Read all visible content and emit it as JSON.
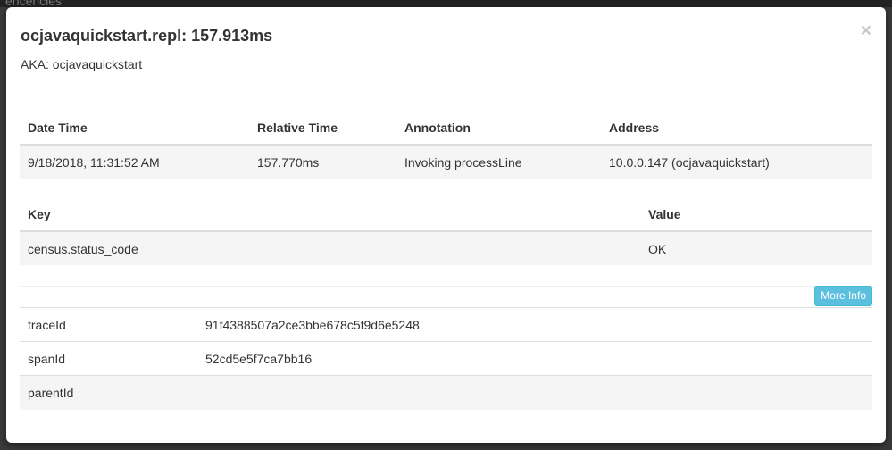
{
  "backdrop": {
    "partial_text": "encencies"
  },
  "modal": {
    "title": "ocjavaquickstart.repl: 157.913ms",
    "aka": "AKA: ocjavaquickstart",
    "close_glyph": "×"
  },
  "annotations": {
    "headers": [
      "Date Time",
      "Relative Time",
      "Annotation",
      "Address"
    ],
    "rows": [
      [
        "9/18/2018, 11:31:52 AM",
        "157.770ms",
        "Invoking processLine",
        "10.0.0.147 (ocjavaquickstart)"
      ]
    ]
  },
  "binary_annotations": {
    "headers": [
      "Key",
      "Value"
    ],
    "rows": [
      [
        "census.status_code",
        "OK"
      ]
    ]
  },
  "more_info_label": "More Info",
  "ids": [
    {
      "key": "traceId",
      "value": "91f4388507a2ce3bbe678c5f9d6e5248"
    },
    {
      "key": "spanId",
      "value": "52cd5e5f7ca7bb16"
    },
    {
      "key": "parentId",
      "value": ""
    }
  ],
  "colors": {
    "info_button": "#5bc0de",
    "stripe": "#f5f5f5",
    "backdrop": "#3a3a3a"
  }
}
